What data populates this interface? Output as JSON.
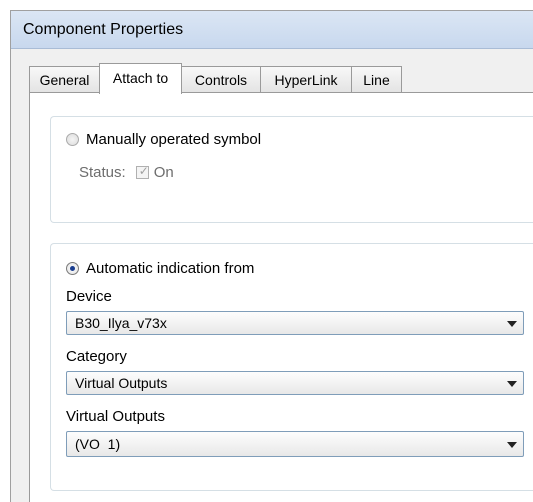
{
  "window": {
    "title": "Component Properties"
  },
  "tabs": [
    {
      "label": "General"
    },
    {
      "label": "Attach to"
    },
    {
      "label": "Controls"
    },
    {
      "label": "HyperLink"
    },
    {
      "label": "Line"
    }
  ],
  "active_tab": "Attach to",
  "manual": {
    "radio_label": "Manually operated symbol",
    "selected": false,
    "status_label": "Status:",
    "on_label": "On",
    "on_checked": true,
    "disabled": true
  },
  "automatic": {
    "radio_label": "Automatic indication from",
    "selected": true,
    "device_label": "Device",
    "device_value": "B30_Ilya_v73x",
    "category_label": "Category",
    "category_value": "Virtual Outputs",
    "item_label": "Virtual Outputs",
    "item_value": "(VO  1)"
  }
}
